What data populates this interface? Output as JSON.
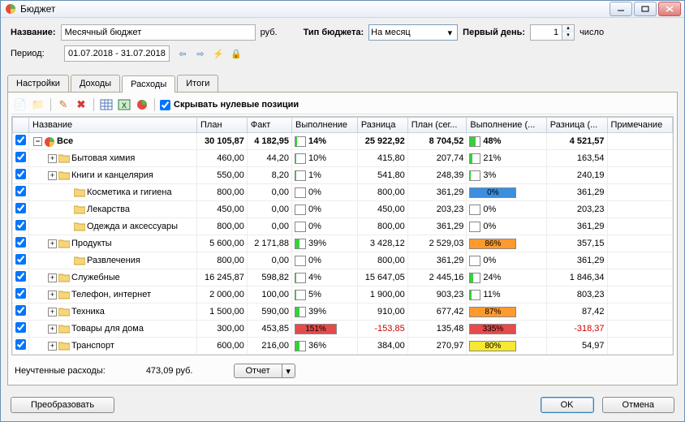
{
  "window": {
    "title": "Бюджет"
  },
  "form": {
    "name_label": "Название:",
    "name_value": "Месячный бюджет",
    "currency": "руб.",
    "type_label": "Тип бюджета:",
    "type_value": "На месяц",
    "firstday_label": "Первый день:",
    "firstday_value": "1",
    "firstday_unit": "число",
    "period_label": "Период:",
    "period_value": "01.07.2018 - 31.07.2018"
  },
  "tabs": [
    "Настройки",
    "Доходы",
    "Расходы",
    "Итоги"
  ],
  "active_tab": 2,
  "toolbar": {
    "hide_zero_label": "Скрывать нулевые позиции",
    "hide_zero_checked": true
  },
  "columns": [
    "Название",
    "План",
    "Факт",
    "Выполнение",
    "Разница",
    "План (сег...",
    "Выполнение (...",
    "Разница (...",
    "Примечание"
  ],
  "rows": [
    {
      "name": "Все",
      "level": 0,
      "expandable": true,
      "expanded": true,
      "root": true,
      "bold": true,
      "plan": "30 105,87",
      "fact": "4 182,95",
      "exec_pct": 14,
      "exec_color": "#36d13a",
      "exec_full": false,
      "diff": "25 922,92",
      "plan_today": "8 704,52",
      "exec2_pct": 48,
      "exec2_label": "48%",
      "exec2_color": "#36d13a",
      "exec2_full": false,
      "diff2": "4 521,57"
    },
    {
      "name": "Бытовая химия",
      "level": 1,
      "expandable": true,
      "plan": "460,00",
      "fact": "44,20",
      "exec_pct": 10,
      "exec_color": "#36d13a",
      "diff": "415,80",
      "plan_today": "207,74",
      "exec2_pct": 21,
      "exec2_label": "21%",
      "exec2_color": "#36d13a",
      "diff2": "163,54"
    },
    {
      "name": "Книги и канцелярия",
      "level": 1,
      "expandable": true,
      "plan": "550,00",
      "fact": "8,20",
      "exec_pct": 1,
      "exec_color": "#36d13a",
      "diff": "541,80",
      "plan_today": "248,39",
      "exec2_pct": 3,
      "exec2_label": "3%",
      "exec2_color": "#36d13a",
      "diff2": "240,19"
    },
    {
      "name": "Косметика и гигиена",
      "level": 2,
      "plan": "800,00",
      "fact": "0,00",
      "exec_pct": 0,
      "exec_color": "#36d13a",
      "diff": "800,00",
      "plan_today": "361,29",
      "exec2_pct": 0,
      "exec2_label": "0%",
      "exec2_full": true,
      "exec2_color": "#3a8fe0",
      "diff2": "361,29"
    },
    {
      "name": "Лекарства",
      "level": 2,
      "plan": "450,00",
      "fact": "0,00",
      "exec_pct": 0,
      "exec_color": "#36d13a",
      "diff": "450,00",
      "plan_today": "203,23",
      "exec2_pct": 0,
      "exec2_label": "0%",
      "exec2_color": "#36d13a",
      "diff2": "203,23"
    },
    {
      "name": "Одежда и аксессуары",
      "level": 2,
      "plan": "800,00",
      "fact": "0,00",
      "exec_pct": 0,
      "exec_color": "#36d13a",
      "diff": "800,00",
      "plan_today": "361,29",
      "exec2_pct": 0,
      "exec2_label": "0%",
      "exec2_color": "#36d13a",
      "diff2": "361,29"
    },
    {
      "name": "Продукты",
      "level": 1,
      "expandable": true,
      "plan": "5 600,00",
      "fact": "2 171,88",
      "exec_pct": 39,
      "exec_color": "#36d13a",
      "diff": "3 428,12",
      "plan_today": "2 529,03",
      "exec2_pct": 86,
      "exec2_label": "86%",
      "exec2_full": true,
      "exec2_color": "#ff9b2e",
      "diff2": "357,15"
    },
    {
      "name": "Развлечения",
      "level": 2,
      "plan": "800,00",
      "fact": "0,00",
      "exec_pct": 0,
      "exec_color": "#36d13a",
      "diff": "800,00",
      "plan_today": "361,29",
      "exec2_pct": 0,
      "exec2_label": "0%",
      "exec2_color": "#36d13a",
      "diff2": "361,29"
    },
    {
      "name": "Служебные",
      "level": 1,
      "expandable": true,
      "plan": "16 245,87",
      "fact": "598,82",
      "exec_pct": 4,
      "exec_color": "#36d13a",
      "diff": "15 647,05",
      "plan_today": "2 445,16",
      "exec2_pct": 24,
      "exec2_label": "24%",
      "exec2_color": "#36d13a",
      "diff2": "1 846,34"
    },
    {
      "name": "Телефон, интернет",
      "level": 1,
      "expandable": true,
      "plan": "2 000,00",
      "fact": "100,00",
      "exec_pct": 5,
      "exec_color": "#36d13a",
      "diff": "1 900,00",
      "plan_today": "903,23",
      "exec2_pct": 11,
      "exec2_label": "11%",
      "exec2_color": "#36d13a",
      "diff2": "803,23"
    },
    {
      "name": "Техника",
      "level": 1,
      "expandable": true,
      "plan": "1 500,00",
      "fact": "590,00",
      "exec_pct": 39,
      "exec_color": "#36d13a",
      "diff": "910,00",
      "plan_today": "677,42",
      "exec2_pct": 87,
      "exec2_label": "87%",
      "exec2_full": true,
      "exec2_color": "#ff9b2e",
      "diff2": "87,42"
    },
    {
      "name": "Товары для дома",
      "level": 1,
      "expandable": true,
      "plan": "300,00",
      "fact": "453,85",
      "exec_pct": 151,
      "exec_full": true,
      "exec_color": "#e74a4a",
      "diff": "-153,85",
      "diff_neg": true,
      "plan_today": "135,48",
      "exec2_pct": 335,
      "exec2_label": "335%",
      "exec2_full": true,
      "exec2_color": "#e74a4a",
      "diff2": "-318,37",
      "diff2_neg": true
    },
    {
      "name": "Транспорт",
      "level": 1,
      "expandable": true,
      "plan": "600,00",
      "fact": "216,00",
      "exec_pct": 36,
      "exec_color": "#36d13a",
      "diff": "384,00",
      "plan_today": "270,97",
      "exec2_pct": 80,
      "exec2_label": "80%",
      "exec2_full": true,
      "exec2_color": "#f7e931",
      "diff2": "54,97"
    }
  ],
  "footer": {
    "unaccounted_label": "Неучтенные расходы:",
    "unaccounted_value": "473,09 руб.",
    "report_label": "Отчет"
  },
  "buttons": {
    "transform": "Преобразовать",
    "ok": "OK",
    "cancel": "Отмена"
  },
  "colors": {
    "green": "#36d13a",
    "orange": "#ff9b2e",
    "red": "#e74a4a",
    "yellow": "#f7e931",
    "blue": "#3a8fe0"
  }
}
